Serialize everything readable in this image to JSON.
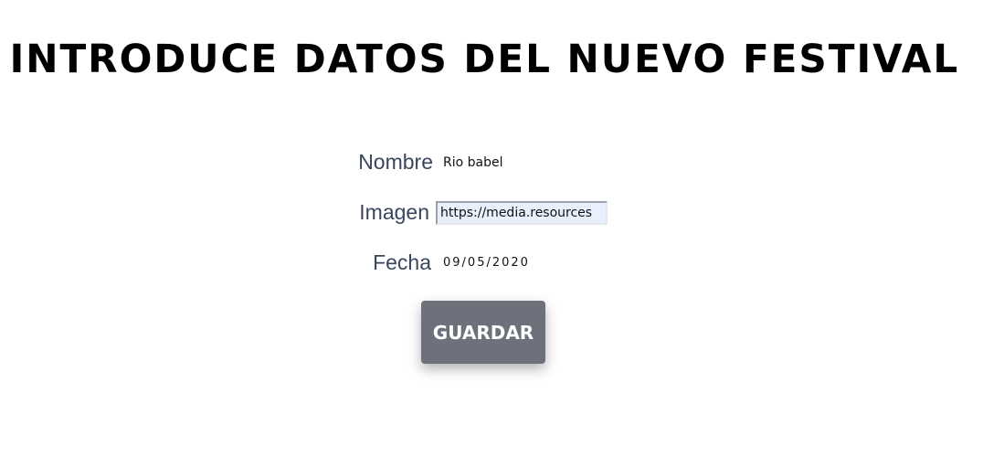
{
  "title": "INTRODUCE DATOS DEL NUEVO FESTIVAL",
  "form": {
    "nombre": {
      "label": "Nombre",
      "value": "Rio babel"
    },
    "imagen": {
      "label": "Imagen",
      "value": "https://media.resources"
    },
    "fecha": {
      "label": "Fecha",
      "value": "09/05/2020"
    }
  },
  "save_button": {
    "label": "GUARDAR"
  },
  "colors": {
    "label_text": "#3a465e",
    "button_bg": "#6c717b",
    "input_autofill_bg": "#e8f0fe"
  }
}
